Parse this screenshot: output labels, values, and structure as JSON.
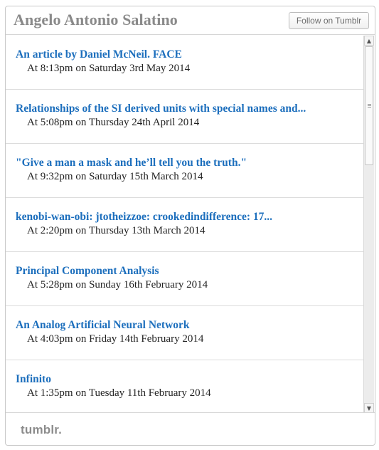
{
  "header": {
    "title": "Angelo Antonio Salatino",
    "follow_label": "Follow on Tumblr"
  },
  "posts": [
    {
      "title": "An article by Daniel McNeil. FACE",
      "date": "At 8:13pm on Saturday 3rd May 2014"
    },
    {
      "title": "Relationships of the SI derived units with special names and...",
      "date": "At 5:08pm on Thursday 24th April 2014"
    },
    {
      "title": "\"Give a man a mask and he’ll tell you the truth.\"",
      "date": "At 9:32pm on Saturday 15th March 2014"
    },
    {
      "title": "kenobi-wan-obi: jtotheizzoe: crookedindifference: 17...",
      "date": "At 2:20pm on Thursday 13th March 2014"
    },
    {
      "title": "Principal Component Analysis",
      "date": "At 5:28pm on Sunday 16th February 2014"
    },
    {
      "title": "An Analog Artificial Neural Network",
      "date": "At 4:03pm on Friday 14th February 2014"
    },
    {
      "title": "Infinito",
      "date": "At 1:35pm on Tuesday 11th February 2014"
    }
  ],
  "scrollbar": {
    "up_icon": "▲",
    "down_icon": "▼"
  },
  "footer": {
    "logo": "tumblr."
  }
}
